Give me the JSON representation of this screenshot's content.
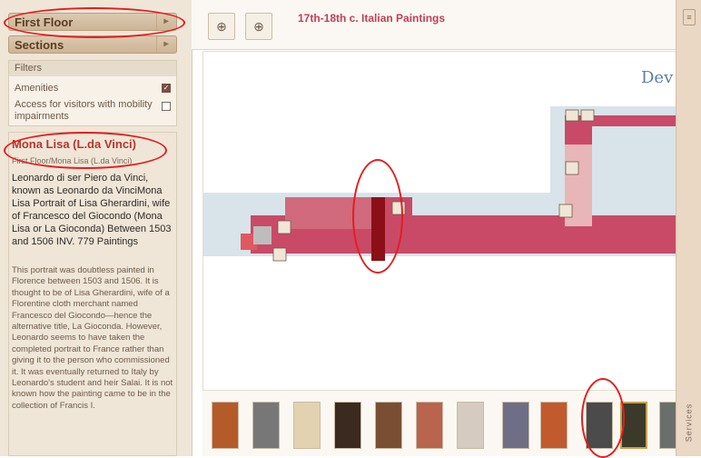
{
  "sidebar": {
    "accordion": [
      {
        "label": "First Floor"
      },
      {
        "label": "Sections"
      }
    ],
    "filters": {
      "title": "Filters",
      "items": [
        {
          "label": "Amenities",
          "checked": true
        },
        {
          "label": "Access for visitors with mobility impairments",
          "checked": false
        }
      ]
    },
    "info": {
      "title": "Mona Lisa (L.da Vinci)",
      "path": "First Floor/Mona Lisa (L.da Vinci)",
      "description": "Leonardo di ser Piero da Vinci, known as Leonardo da VinciMona Lisa Portrait of Lisa Gherardini, wife of Francesco del Giocondo (Mona Lisa or La Gioconda) Between 1503 and 1506 INV. 779 Paintings",
      "body": "This portrait was doubtless painted in Florence between 1503 and 1506. It is thought to be of Lisa Gherardini, wife of a Florentine cloth merchant named Francesco del Giocondo—hence the alternative title, La Gioconda. However, Leonardo seems to have taken the completed portrait to France rather than giving it to the person who commissioned it. It was eventually returned to Italy by Leonardo's student and heir Salai. It is not known how the painting came to be in the collection of Francis I."
    }
  },
  "toolbar": {
    "zoom_out_icon": "zoom-out-icon",
    "zoom_in_icon": "zoom-in-icon",
    "map_title": "17th-18th c. Italian Paintings"
  },
  "map": {
    "label": "Dev"
  },
  "services": {
    "label": "Services"
  },
  "colors": {
    "accent_red": "#c13f56",
    "highlight_dark_red": "#8b0f17",
    "floor_pink": "#c94a67",
    "annotation_red": "#e31e1e"
  },
  "thumbnails": [
    {
      "name": "thumb-1",
      "color": "#b55b2a"
    },
    {
      "name": "thumb-2",
      "color": "#777777"
    },
    {
      "name": "thumb-3",
      "color": "#e3d2b0"
    },
    {
      "name": "thumb-4",
      "color": "#3a2a20"
    },
    {
      "name": "thumb-5",
      "color": "#7a4e33"
    },
    {
      "name": "thumb-6",
      "color": "#b9644d"
    },
    {
      "name": "thumb-7",
      "color": "#d5cbc0"
    },
    {
      "name": "thumb-8",
      "color": "#6e6f86"
    },
    {
      "name": "thumb-9",
      "color": "#c15b2e"
    },
    {
      "name": "thumb-10",
      "color": "#4b4b4b"
    },
    {
      "name": "thumb-mona-lisa",
      "color": "#3b3a2a"
    },
    {
      "name": "thumb-12",
      "color": "#6a6f6b"
    }
  ]
}
